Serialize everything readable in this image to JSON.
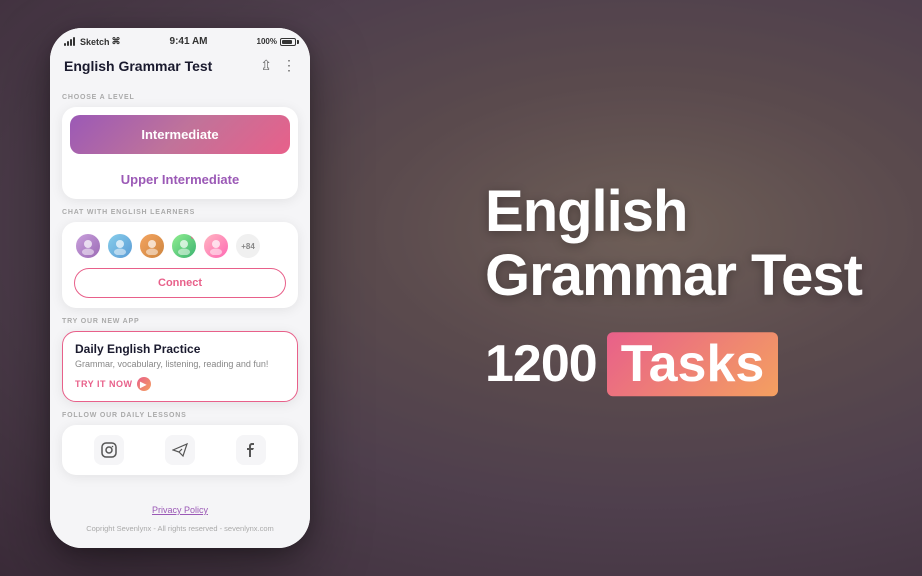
{
  "background": {
    "color_left": "#6b5a6e",
    "color_right": "#8a7060"
  },
  "right_panel": {
    "title_line1": "English",
    "title_line2": "Grammar Test",
    "tasks_number": "1200",
    "tasks_label": "Tasks"
  },
  "phone": {
    "status_bar": {
      "carrier": "Sketch",
      "time": "9:41 AM",
      "battery": "100%"
    },
    "app_header": {
      "title": "English Grammar Test"
    },
    "sections": {
      "choose_level_label": "CHOOSE A LEVEL",
      "chat_label": "CHAT WITH ENGLISH LEARNERS",
      "app_promo_label": "TRY OUR NEW APP",
      "follow_label": "FOLLOW OUR DAILY LESSONS"
    },
    "levels": [
      {
        "label": "Intermediate",
        "active": true
      },
      {
        "label": "Upper Intermediate",
        "active": false
      }
    ],
    "chat": {
      "avatar_count": "+84",
      "connect_button": "Connect"
    },
    "app_promo": {
      "title": "Daily English Practice",
      "description": "Grammar, vocabulary, listening, reading and fun!",
      "cta": "TRY IT NOW"
    },
    "footer": {
      "privacy_label": "Privacy Policy",
      "copyright": "Copright Sevenlynx - All rights reserved - sevenlynx.com"
    }
  }
}
